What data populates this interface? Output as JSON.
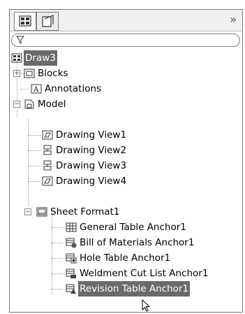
{
  "header": {
    "more_glyph": "»"
  },
  "tree": {
    "root": "Draw3",
    "items": [
      {
        "label": "Blocks",
        "icon": "blocks-icon",
        "expander": "+"
      },
      {
        "label": "Annotations",
        "icon": "annotations-icon"
      },
      {
        "label": "Model",
        "icon": "model-icon",
        "expander": "−"
      },
      {
        "label": "Drawing View1",
        "icon": "drawing-view-icon"
      },
      {
        "label": "Drawing View2",
        "icon": "drawing-view-section-icon"
      },
      {
        "label": "Drawing View3",
        "icon": "drawing-view-section-icon"
      },
      {
        "label": "Drawing View4",
        "icon": "drawing-view-icon"
      },
      {
        "label": "Sheet Format1",
        "icon": "sheet-format-icon",
        "expander": "−"
      },
      {
        "label": "General Table Anchor1",
        "icon": "general-table-icon"
      },
      {
        "label": "Bill of Materials Anchor1",
        "icon": "bom-table-icon"
      },
      {
        "label": "Hole Table Anchor1",
        "icon": "hole-table-icon"
      },
      {
        "label": "Weldment Cut List Anchor1",
        "icon": "weldment-table-icon"
      },
      {
        "label": "Revision Table Anchor1",
        "icon": "revision-table-icon",
        "selected": true
      }
    ]
  }
}
